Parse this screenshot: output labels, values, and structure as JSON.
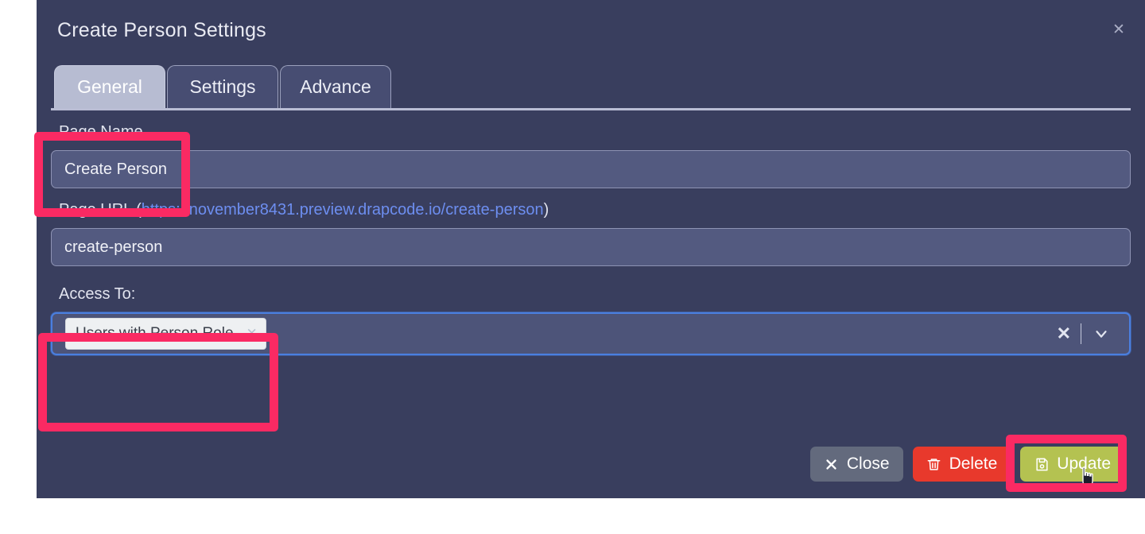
{
  "modal": {
    "title": "Create Person Settings",
    "close_icon": "close-icon",
    "tabs": [
      {
        "label": "General",
        "active": true
      },
      {
        "label": "Settings",
        "active": false
      },
      {
        "label": "Advance",
        "active": false
      }
    ],
    "fields": {
      "page_name": {
        "label": "Page Name",
        "value": "Create Person",
        "placeholder": "Page Name"
      },
      "page_url": {
        "label_prefix": "Page URL (",
        "url": "https://november8431.preview.drapcode.io/create-person",
        "label_suffix": ")",
        "value": "create-person",
        "placeholder": "Page URL"
      },
      "access_to": {
        "label": "Access To:",
        "chips": [
          {
            "label": "Users with Person Role",
            "remove_icon": "chip-remove-icon"
          }
        ],
        "clear_icon": "clear-icon",
        "caret_icon": "chevron-down-icon"
      }
    },
    "footer": {
      "buttons": [
        {
          "label": "Close",
          "icon": "close-x-icon",
          "style": "close"
        },
        {
          "label": "Delete",
          "icon": "trash-icon",
          "style": "delete"
        },
        {
          "label": "Update",
          "icon": "save-disk-icon",
          "style": "update"
        }
      ]
    }
  },
  "annotations": {
    "page_name_highlight": "page-name-highlight",
    "access_to_highlight": "access-to-highlight",
    "update_button_highlight": "update-button-highlight"
  },
  "colors": {
    "modal_bg": "#393e5e",
    "input_bg": "#535a80",
    "tab_active_bg": "#b7bcd2",
    "tab_inactive_bg": "#474d72",
    "link": "#6d8ef0",
    "focus_border": "#4a7fe0",
    "annotation": "#fa2a63",
    "btn_close": "#636a7d",
    "btn_delete": "#e8392c",
    "btn_update": "#b4c251"
  }
}
